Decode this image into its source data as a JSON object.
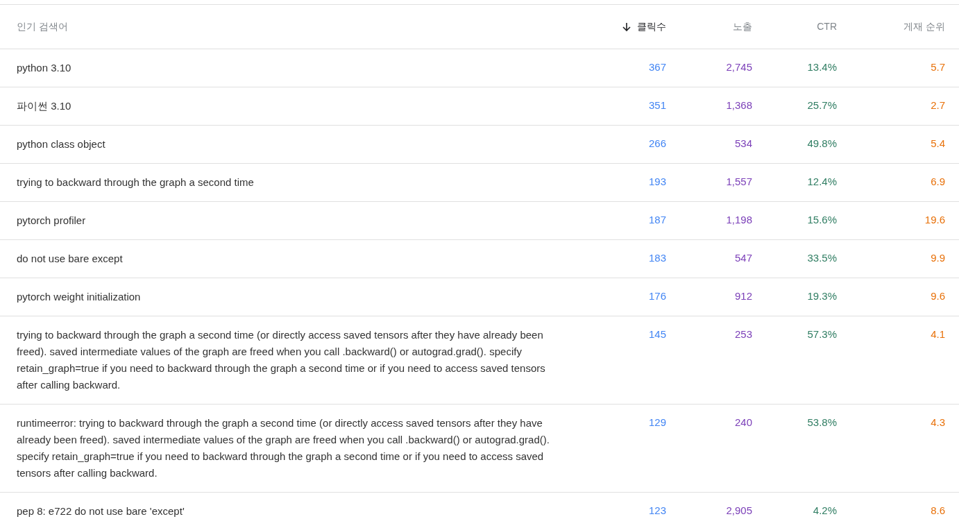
{
  "table": {
    "columns": [
      {
        "label": "인기 검색어",
        "sorted": false
      },
      {
        "label": "클릭수",
        "sorted": true,
        "color": "#4285f4"
      },
      {
        "label": "노출",
        "sorted": false,
        "color": "#7b3fb8"
      },
      {
        "label": "CTR",
        "sorted": false,
        "color": "#2f7d62"
      },
      {
        "label": "게재 순위",
        "sorted": false,
        "color": "#e8710a"
      }
    ],
    "rows": [
      [
        "python 3.10",
        "367",
        "2,745",
        "13.4%",
        "5.7"
      ],
      [
        "파이썬 3.10",
        "351",
        "1,368",
        "25.7%",
        "2.7"
      ],
      [
        "python class object",
        "266",
        "534",
        "49.8%",
        "5.4"
      ],
      [
        "trying to backward through the graph a second time",
        "193",
        "1,557",
        "12.4%",
        "6.9"
      ],
      [
        "pytorch profiler",
        "187",
        "1,198",
        "15.6%",
        "19.6"
      ],
      [
        "do not use bare except",
        "183",
        "547",
        "33.5%",
        "9.9"
      ],
      [
        "pytorch weight initialization",
        "176",
        "912",
        "19.3%",
        "9.6"
      ],
      [
        "trying to backward through the graph a second time (or directly access saved tensors after they have already been freed). saved intermediate values of the graph are freed when you call .backward() or autograd.grad(). specify retain_graph=true if you need to backward through the graph a second time or if you need to access saved tensors after calling backward.",
        "145",
        "253",
        "57.3%",
        "4.1"
      ],
      [
        "runtimeerror: trying to backward through the graph a second time (or directly access saved tensors after they have already been freed). saved intermediate values of the graph are freed when you call .backward() or autograd.grad(). specify retain_graph=true if you need to backward through the graph a second time or if you need to access saved tensors after calling backward.",
        "129",
        "240",
        "53.8%",
        "4.3"
      ],
      [
        "pep 8: e722 do not use bare 'except'",
        "123",
        "2,905",
        "4.2%",
        "8.6"
      ]
    ]
  }
}
